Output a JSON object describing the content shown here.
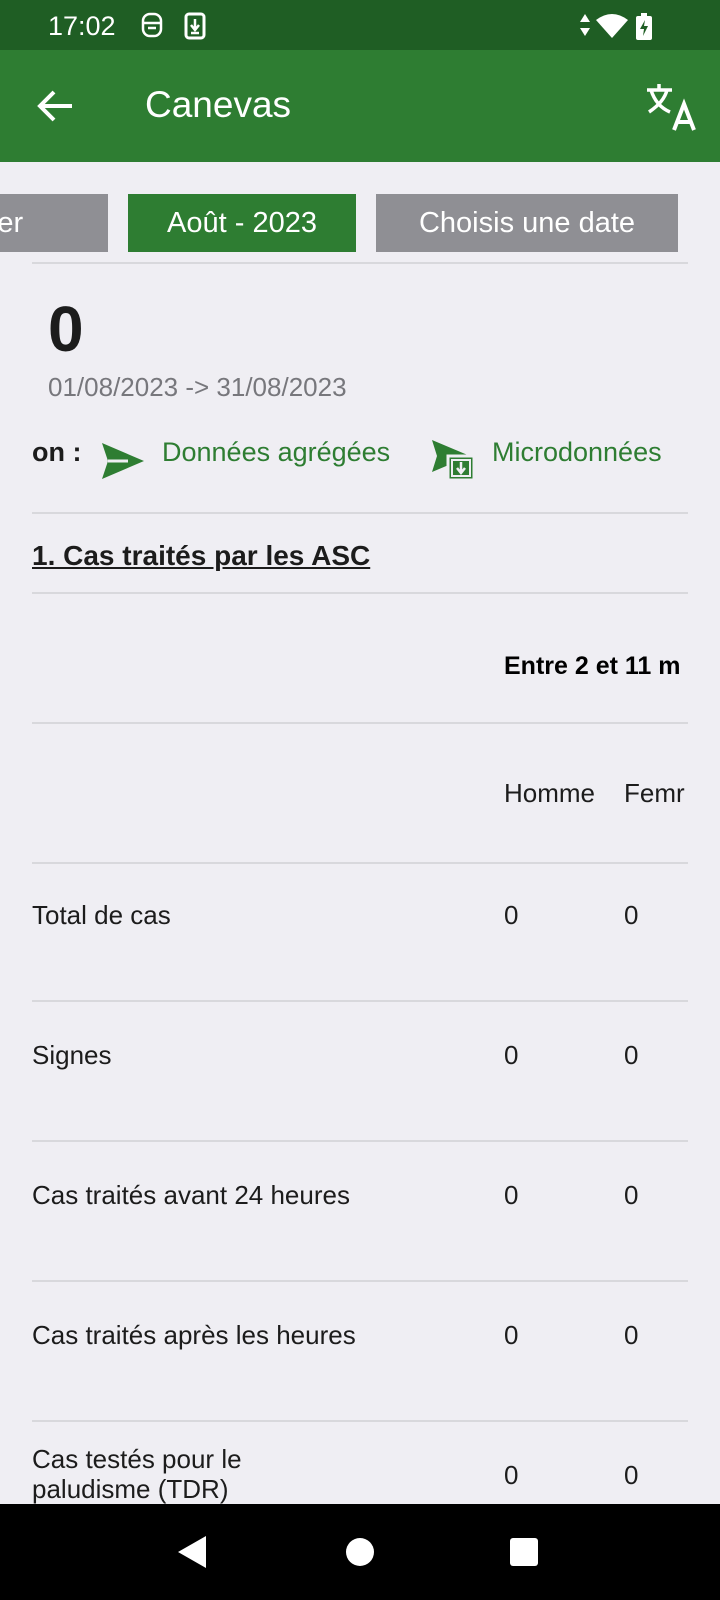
{
  "status_bar": {
    "time": "17:02"
  },
  "app_bar": {
    "title": "Canevas"
  },
  "period_chips": {
    "yesterday": "Hier",
    "month": "Août - 2023",
    "choose_date": "Choisis une date"
  },
  "summary": {
    "count": "0",
    "date_range": "01/08/2023 -> 31/08/2023"
  },
  "export": {
    "label": "on :",
    "aggregated": "Données agrégées",
    "microdata": "Microdonnées"
  },
  "section": {
    "title": "1. Cas traités par les ASC"
  },
  "table": {
    "group_header": "Entre 2 et 11 m",
    "columns": [
      "Homme",
      "Femr"
    ],
    "rows": [
      {
        "label": "Total de cas",
        "values": [
          "0",
          "0"
        ]
      },
      {
        "label": "Signes",
        "values": [
          "0",
          "0"
        ]
      },
      {
        "label": "Cas traités avant 24 heures",
        "values": [
          "0",
          "0"
        ]
      },
      {
        "label": "Cas traités après les heures",
        "values": [
          "0",
          "0"
        ]
      },
      {
        "label": "Cas testés pour le paludisme (TDR)",
        "values": [
          "0",
          "0"
        ]
      }
    ]
  },
  "colors": {
    "primary": "#2e7d32",
    "status_bar": "#1f5e24",
    "chip_grey": "#8f8f94",
    "background": "#efeef3"
  },
  "icons": [
    "back-arrow-icon",
    "translate-icon",
    "send-icon",
    "download-icon",
    "back-nav-icon",
    "home-nav-icon",
    "recents-nav-icon"
  ]
}
